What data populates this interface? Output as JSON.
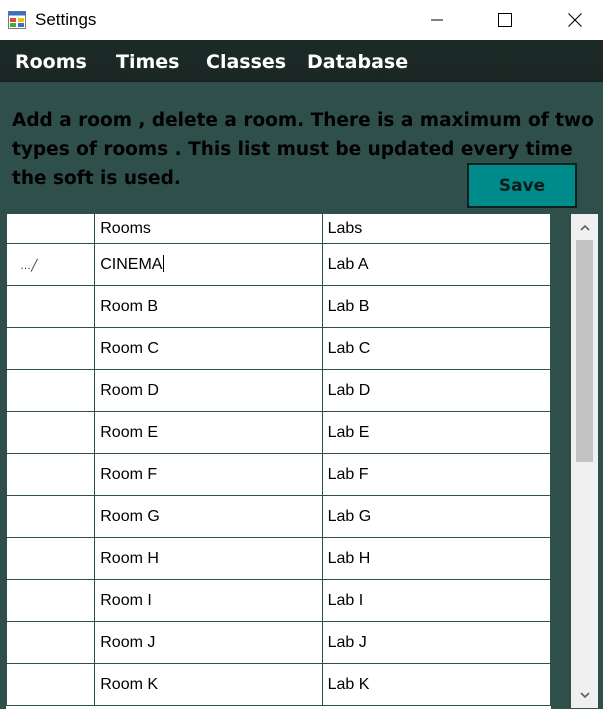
{
  "window": {
    "title": "Settings",
    "app_icon": "form-icon",
    "buttons": [
      "minimize-icon",
      "maximize-icon",
      "close-icon"
    ]
  },
  "menu": {
    "items": [
      {
        "label": "Rooms"
      },
      {
        "label": "Times"
      },
      {
        "label": "Classes"
      },
      {
        "label": "Database"
      }
    ]
  },
  "info_text": "Add a room , delete a room. There is a maximum of two types of rooms . This list must be updated every time the soft is used.",
  "save_label": "Save",
  "grid": {
    "columns": [
      "Rooms",
      "Labs"
    ],
    "rows": [
      {
        "room": "CINEMA",
        "lab": "Lab A",
        "editing": true
      },
      {
        "room": "Room B",
        "lab": "Lab B"
      },
      {
        "room": "Room C",
        "lab": "Lab C"
      },
      {
        "room": "Room D",
        "lab": "Lab D"
      },
      {
        "room": "Room E",
        "lab": "Lab E"
      },
      {
        "room": "Room F",
        "lab": "Lab F"
      },
      {
        "room": "Room G",
        "lab": "Lab G"
      },
      {
        "room": "Room H",
        "lab": "Lab H"
      },
      {
        "room": "Room I",
        "lab": "Lab I"
      },
      {
        "room": "Room J",
        "lab": "Lab J"
      },
      {
        "room": "Room K",
        "lab": "Lab K"
      }
    ],
    "edit_row_icon": "pencil-icon"
  },
  "colors": {
    "background": "#2f4f4a",
    "menubar": "#1d2b28",
    "save_button": "#008b8b"
  }
}
